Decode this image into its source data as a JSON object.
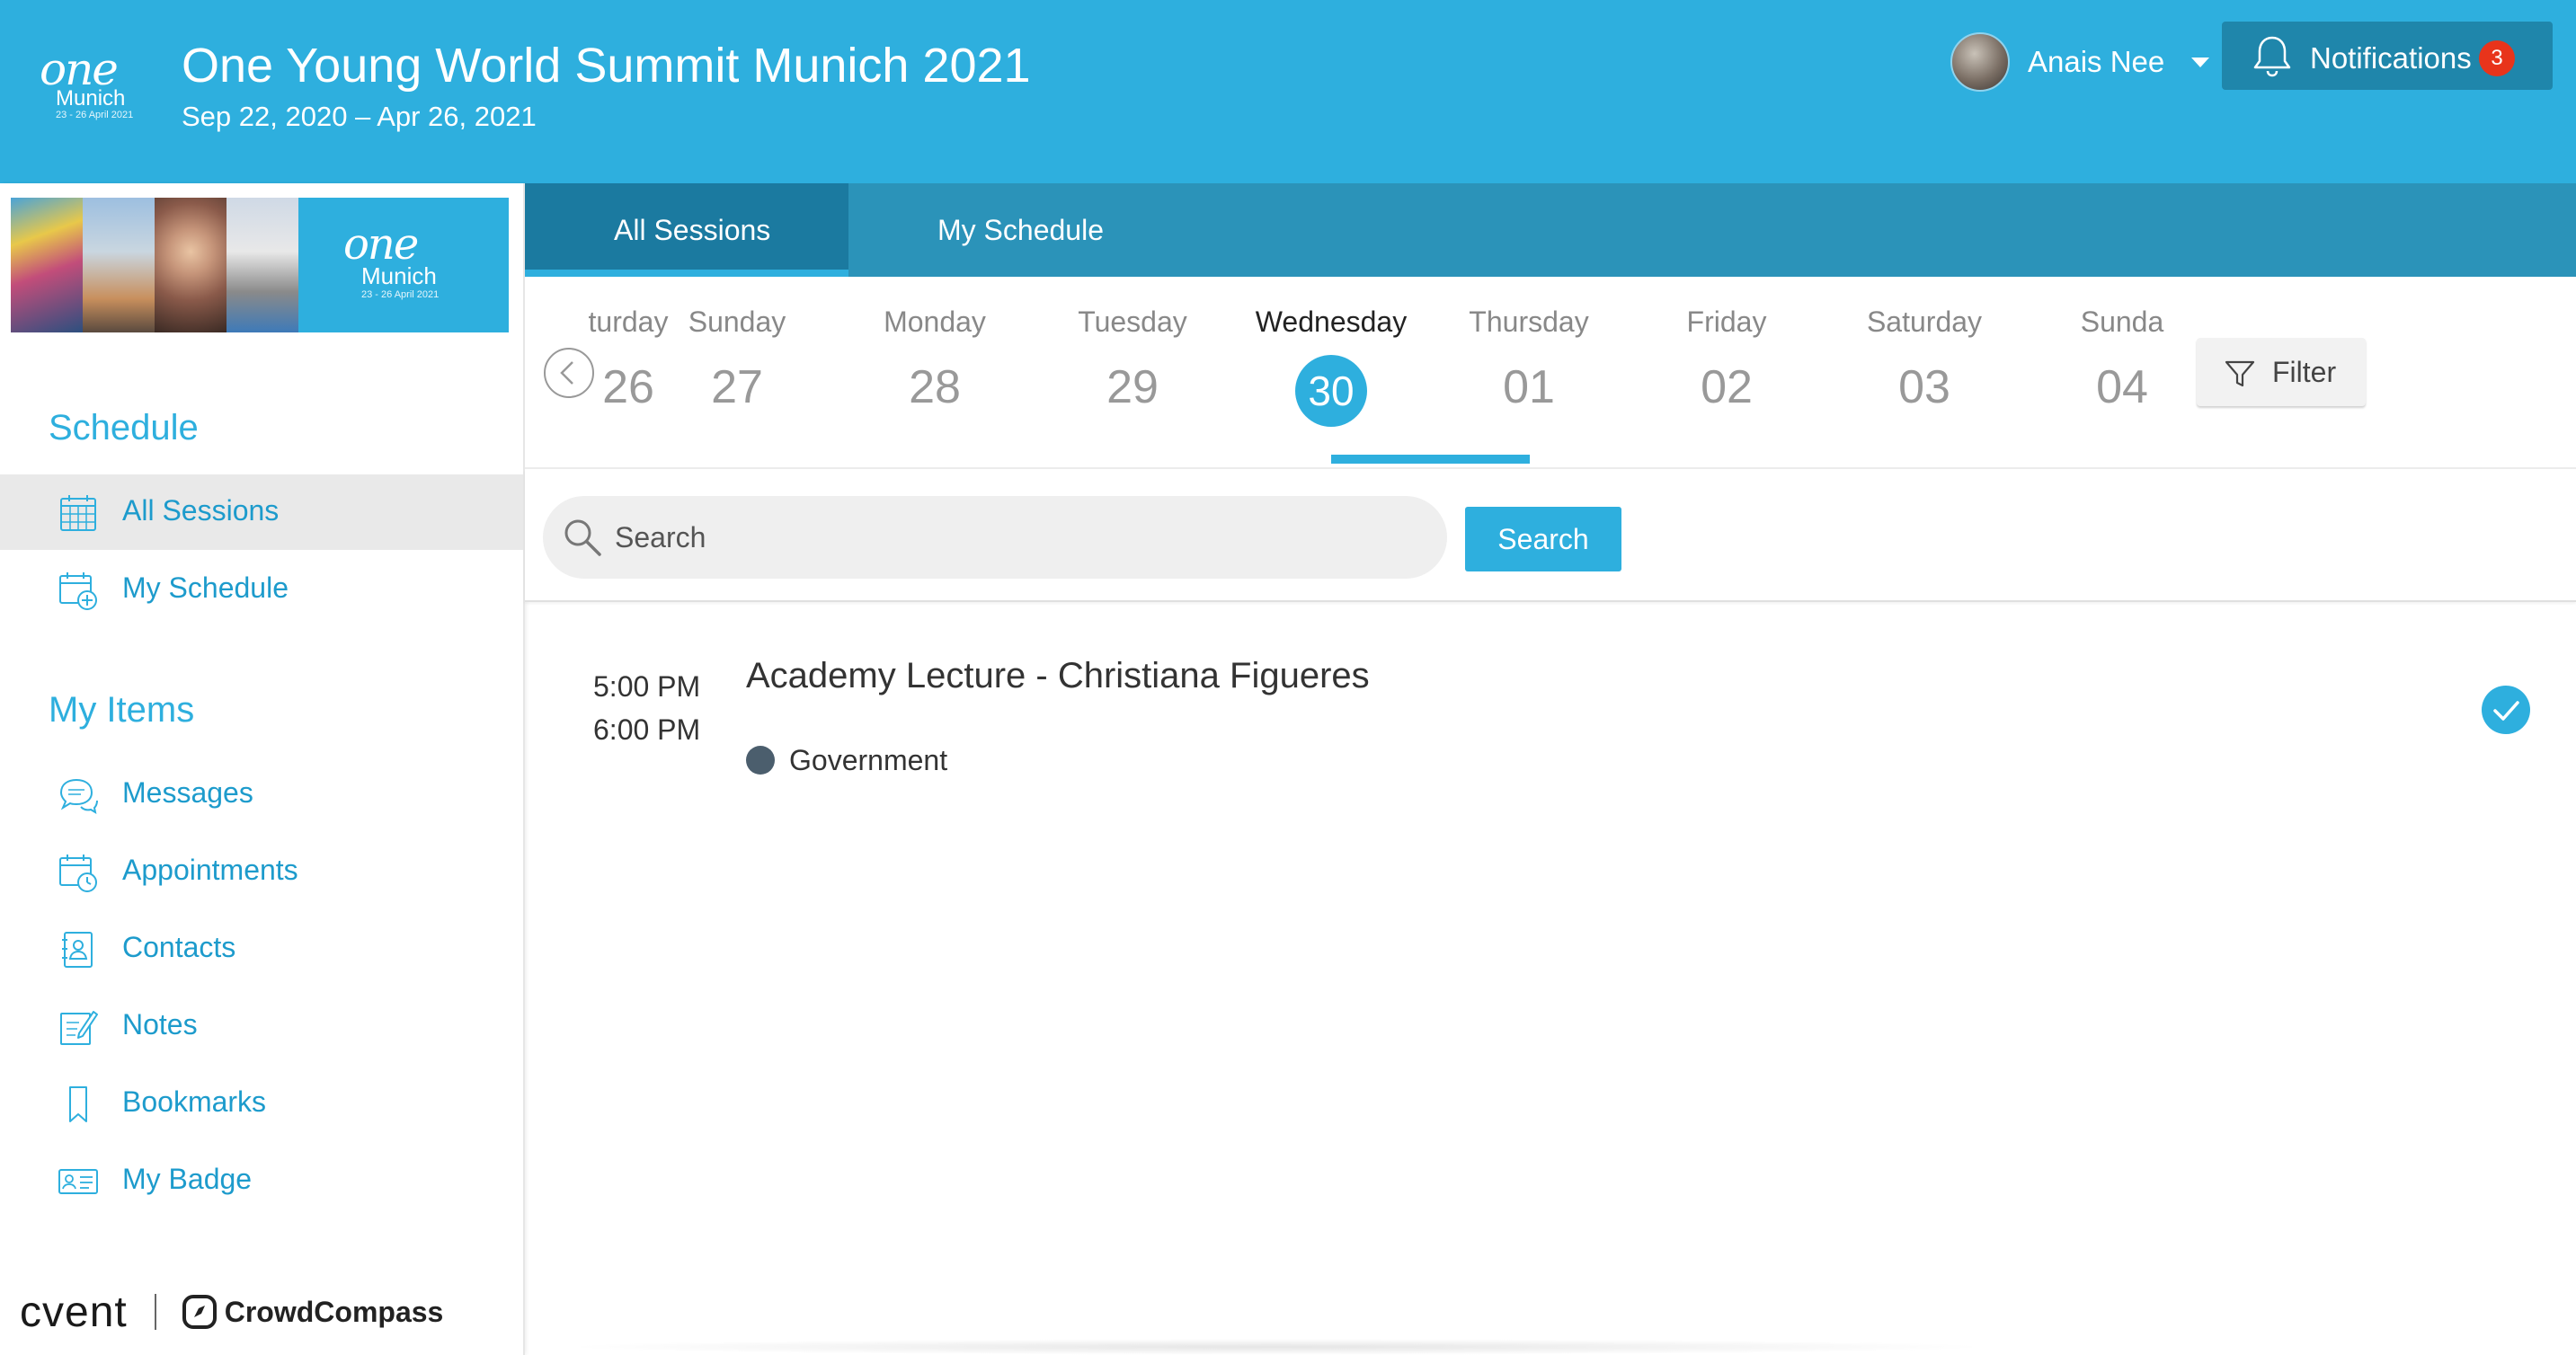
{
  "header": {
    "logo": {
      "word": "one",
      "city": "Munich",
      "dates": "23 - 26 April 2021"
    },
    "title": "One Young World Summit Munich 2021",
    "dates": "Sep 22, 2020 – Apr 26, 2021",
    "user_name": "Anais Nee",
    "notifications_label": "Notifications",
    "notifications_count": "3"
  },
  "sidebar": {
    "banner": {
      "word": "one",
      "city": "Munich",
      "dates": "23 - 26 April 2021"
    },
    "schedule_title": "Schedule",
    "schedule_items": [
      {
        "label": "All Sessions",
        "icon": "calendar-grid-icon",
        "active": true
      },
      {
        "label": "My Schedule",
        "icon": "calendar-add-icon",
        "active": false
      }
    ],
    "my_items_title": "My Items",
    "my_items": [
      {
        "label": "Messages",
        "icon": "chat-bubbles-icon"
      },
      {
        "label": "Appointments",
        "icon": "calendar-clock-icon"
      },
      {
        "label": "Contacts",
        "icon": "contact-book-icon"
      },
      {
        "label": "Notes",
        "icon": "note-edit-icon"
      },
      {
        "label": "Bookmarks",
        "icon": "bookmark-icon"
      },
      {
        "label": "My Badge",
        "icon": "id-badge-icon"
      }
    ],
    "footer": {
      "cvent": "cvent",
      "crowdcompass": "CrowdCompass"
    }
  },
  "tabs": [
    {
      "label": "All Sessions",
      "active": true
    },
    {
      "label": "My Schedule",
      "active": false
    }
  ],
  "days": [
    {
      "name": "turday",
      "num": "26"
    },
    {
      "name": "Sunday",
      "num": "27"
    },
    {
      "name": "Monday",
      "num": "28"
    },
    {
      "name": "Tuesday",
      "num": "29"
    },
    {
      "name": "Wednesday",
      "num": "30",
      "selected": true
    },
    {
      "name": "Thursday",
      "num": "01"
    },
    {
      "name": "Friday",
      "num": "02"
    },
    {
      "name": "Saturday",
      "num": "03"
    },
    {
      "name": "Sunda",
      "num": "04"
    }
  ],
  "filter_label": "Filter",
  "search": {
    "placeholder": "Search",
    "button_label": "Search"
  },
  "session": {
    "start": "5:00 PM",
    "end": "6:00 PM",
    "title": "Academy Lecture - Christiana Figueres",
    "track": "Government",
    "track_color": "#4b5e6d",
    "in_schedule": true
  },
  "colors": {
    "brand": "#2eafde",
    "tabbar": "#2b93b9",
    "badge": "#e8341b"
  }
}
